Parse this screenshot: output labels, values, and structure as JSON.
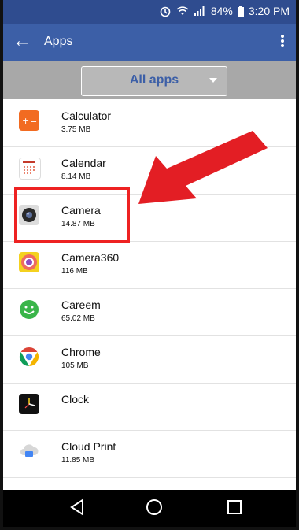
{
  "status": {
    "battery": "84%",
    "time": "3:20 PM"
  },
  "header": {
    "title": "Apps",
    "back_icon": "back-arrow-icon",
    "menu_icon": "overflow-menu-icon"
  },
  "filter": {
    "selected": "All apps"
  },
  "apps": [
    {
      "name": "Calculator",
      "size": "3.75 MB",
      "icon": "calculator-icon"
    },
    {
      "name": "Calendar",
      "size": "8.14 MB",
      "icon": "calendar-icon"
    },
    {
      "name": "Camera",
      "size": "14.87 MB",
      "icon": "camera-icon"
    },
    {
      "name": "Camera360",
      "size": "116 MB",
      "icon": "camera360-icon"
    },
    {
      "name": "Careem",
      "size": "65.02 MB",
      "icon": "careem-icon"
    },
    {
      "name": "Chrome",
      "size": "105 MB",
      "icon": "chrome-icon"
    },
    {
      "name": "Clock",
      "size": "",
      "icon": "clock-icon"
    },
    {
      "name": "Cloud Print",
      "size": "11.85 MB",
      "icon": "cloud-print-icon"
    }
  ],
  "colors": {
    "status_bar": "#2f4c8f",
    "app_bar": "#3c5fa7",
    "filter_bar": "#a8a8a8",
    "highlight": "#ee2222",
    "arrow": "#e31e24"
  },
  "nav": {
    "back_icon": "nav-back-icon",
    "home_icon": "nav-home-icon",
    "recent_icon": "nav-recent-icon"
  }
}
